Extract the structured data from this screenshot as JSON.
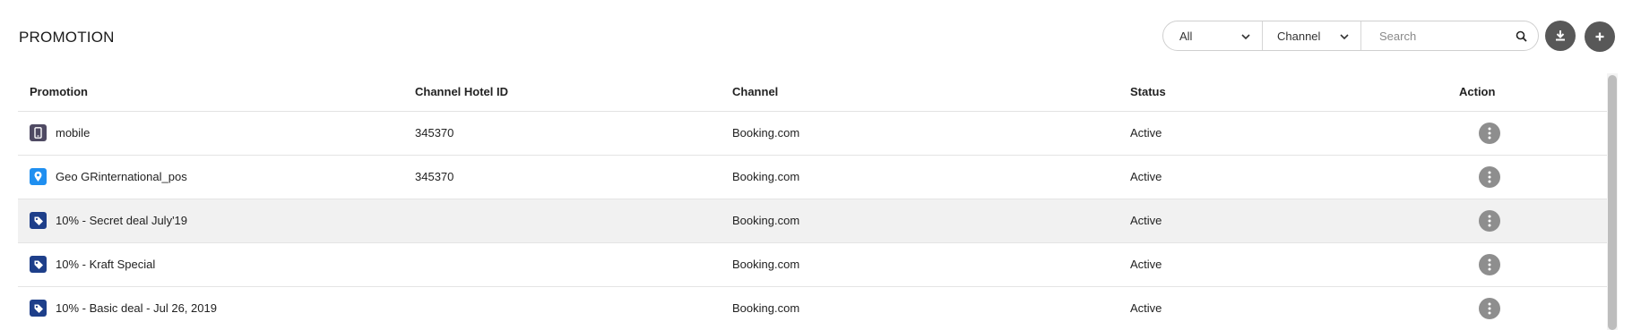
{
  "header": {
    "title": "PROMOTION",
    "filters": {
      "status_select": {
        "value": "All",
        "icon": "chevron-down-icon"
      },
      "channel_select": {
        "value": "Channel",
        "icon": "chevron-down-icon"
      },
      "search": {
        "placeholder": "Search",
        "value": "",
        "icon": "search-icon"
      }
    },
    "buttons": {
      "download": {
        "icon": "download-icon"
      },
      "add": {
        "icon": "plus-icon"
      }
    }
  },
  "table": {
    "columns": [
      "Promotion",
      "Channel Hotel ID",
      "Channel",
      "Status",
      "Action"
    ],
    "rows": [
      {
        "icon": "mobile-icon",
        "icon_color": "#4f4a63",
        "promotion": "mobile",
        "hotel_id": "345370",
        "channel": "Booking.com",
        "status": "Active"
      },
      {
        "icon": "location-pin-icon",
        "icon_color": "#1f8ff0",
        "promotion": "Geo GRinternational_pos",
        "hotel_id": "345370",
        "channel": "Booking.com",
        "status": "Active"
      },
      {
        "icon": "tag-icon",
        "icon_color": "#1e3f8a",
        "promotion": "10% - Secret deal July'19",
        "hotel_id": "",
        "channel": "Booking.com",
        "status": "Active"
      },
      {
        "icon": "tag-icon",
        "icon_color": "#1e3f8a",
        "promotion": "10% - Kraft Special",
        "hotel_id": "",
        "channel": "Booking.com",
        "status": "Active"
      },
      {
        "icon": "tag-icon",
        "icon_color": "#1e3f8a",
        "promotion": "10% - Basic deal - Jul 26, 2019",
        "hotel_id": "",
        "channel": "Booking.com",
        "status": "Active"
      }
    ],
    "action_icon": "kebab-menu-icon"
  },
  "colors": {
    "dark_button": "#585858",
    "action_button": "#8e8e8e",
    "highlight_row": "#f1f1f1"
  }
}
